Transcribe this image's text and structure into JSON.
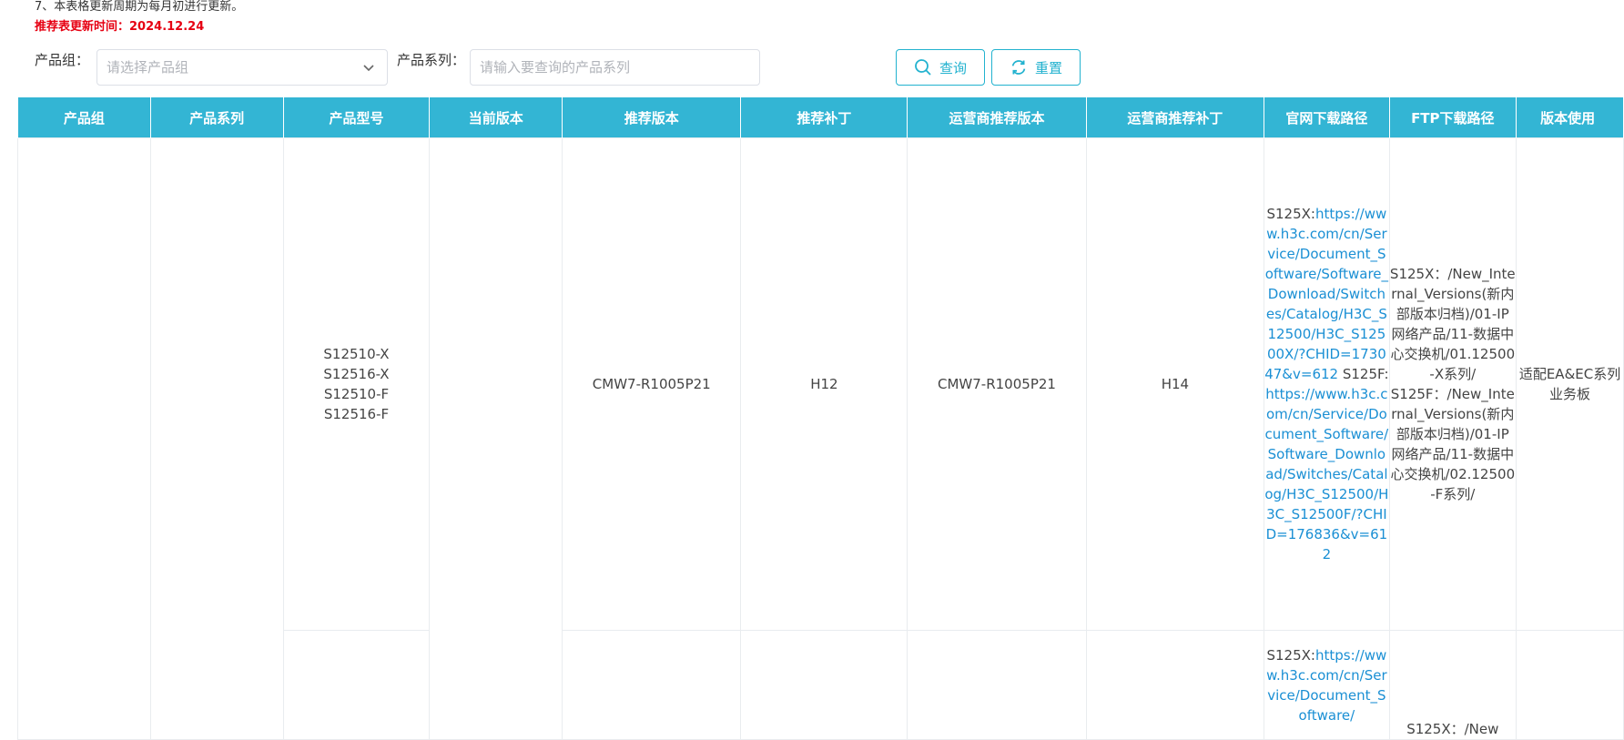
{
  "notice": {
    "line7": "7、本表格更新周期为每月初进行更新。",
    "update_label": "推荐表更新时间：",
    "update_date": "2024.12.24"
  },
  "filters": {
    "product_group_label": "产品组：",
    "product_group_placeholder": "请选择产品组",
    "product_series_label": "产品系列：",
    "product_series_placeholder": "请输入要查询的产品系列",
    "query_label": "查询",
    "reset_label": "重置"
  },
  "table": {
    "headers": [
      "产品组",
      "产品系列",
      "产品型号",
      "当前版本",
      "推荐版本",
      "推荐补丁",
      "运营商推荐版本",
      "运营商推荐补丁",
      "官网下载路径",
      "FTP下载路径",
      "版本使用"
    ],
    "rows": [
      {
        "model": "S12510-X\nS12516-X\nS12510-F\nS12516-F",
        "rec_version": "CMW7-R1005P21",
        "rec_patch": "H12",
        "op_version": "CMW7-R1005P21",
        "op_patch": "H14",
        "web_prefix_1": "S125X:",
        "web_link_1": "https://www.h3c.com/cn/Service/Document_Software/Software_Download/Switches/Catalog/H3C_S12500/H3C_S12500X/?CHID=173047&v=612",
        "web_prefix_2": "S125F:",
        "web_link_2": "https://www.h3c.com/cn/Service/Document_Software/Software_Download/Switches/Catalog/H3C_S12500/H3C_S12500F/?CHID=176836&v=612",
        "ftp": "S125X：/New_Internal_Versions(新内部版本归档)/01-IP网络产品/11-数据中心交换机/01.12500-X系列/\nS125F：/New_Internal_Versions(新内部版本归档)/01-IP网络产品/11-数据中心交换机/02.12500-F系列/",
        "usage": "适配EA&EC系列业务板"
      },
      {
        "web_prefix_1": "S125X:",
        "web_link_1": "https://www.h3c.com/cn/Service/Document_Software/",
        "ftp": "S125X：/New"
      }
    ]
  },
  "colors": {
    "header_bg": "#33b5d4",
    "accent": "#22b2cf",
    "link": "#1a8fd4",
    "alert": "#e60012"
  }
}
